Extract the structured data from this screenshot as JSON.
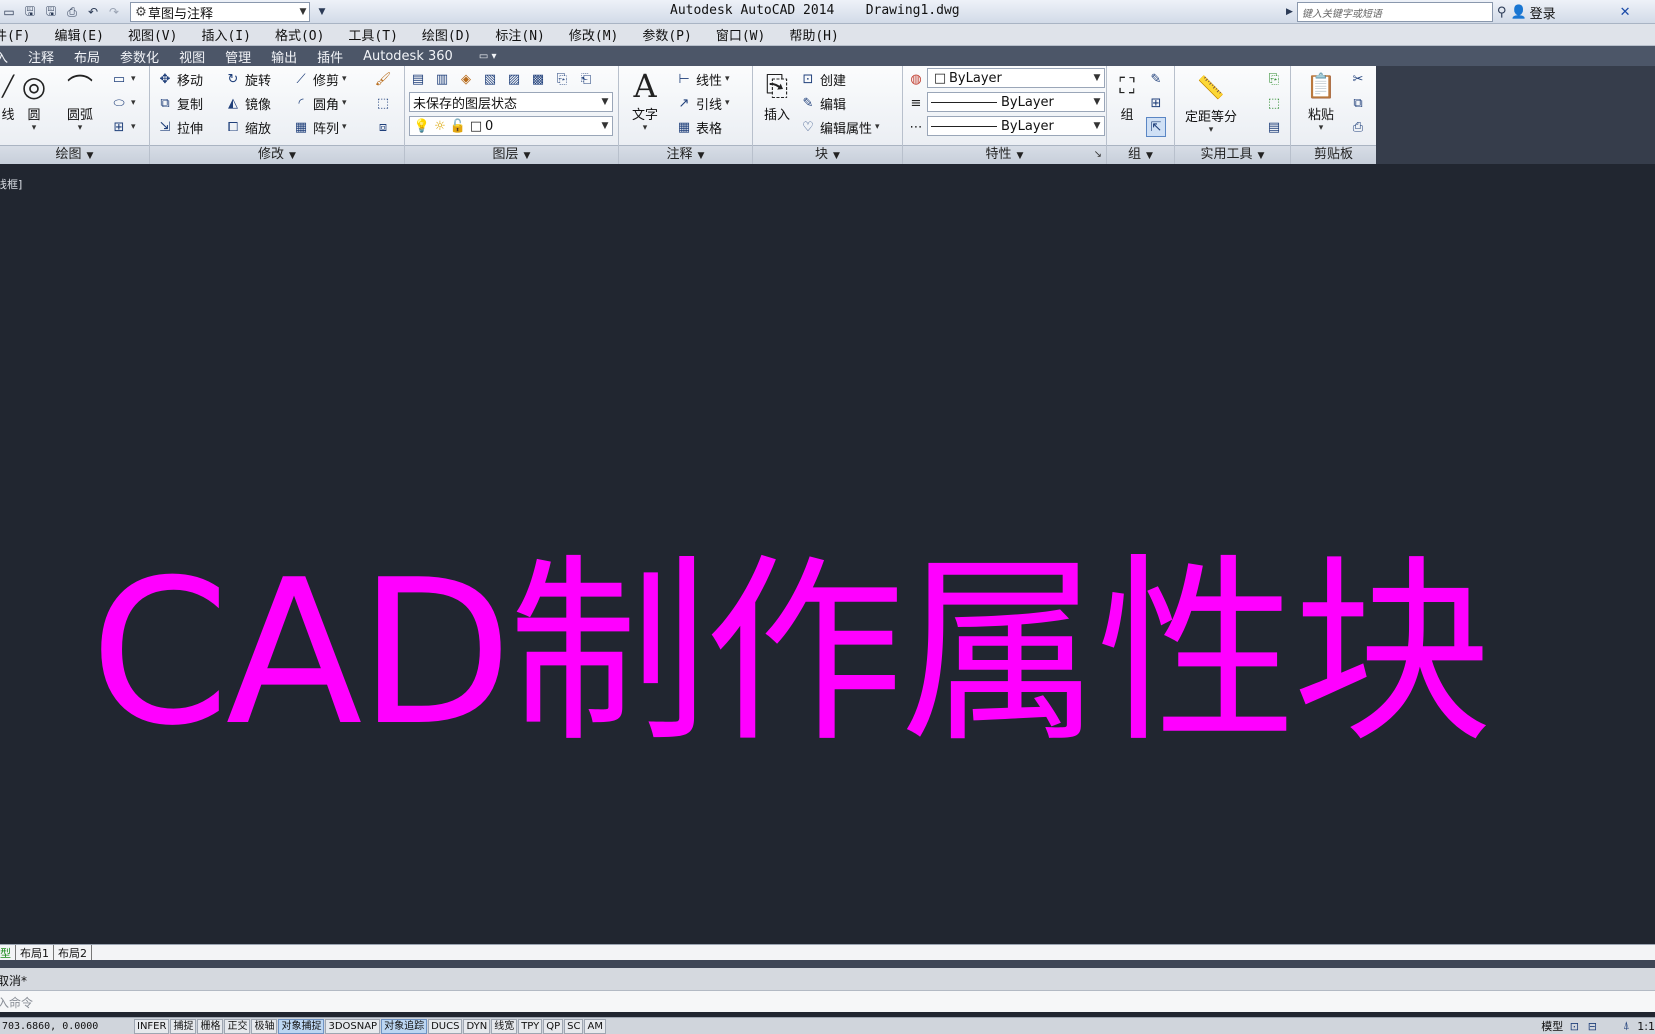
{
  "titlebar": {
    "workspace": "草图与注释",
    "app_title": "Autodesk AutoCAD 2014",
    "file_name": "Drawing1.dwg",
    "search_placeholder": "键入关键字或短语",
    "signin": "登录"
  },
  "menubar": [
    "件(F)",
    "编辑(E)",
    "视图(V)",
    "插入(I)",
    "格式(O)",
    "工具(T)",
    "绘图(D)",
    "标注(N)",
    "修改(M)",
    "参数(P)",
    "窗口(W)",
    "帮助(H)"
  ],
  "ribbon_tabs": [
    "入",
    "注释",
    "布局",
    "参数化",
    "视图",
    "管理",
    "输出",
    "插件",
    "Autodesk 360"
  ],
  "panels": {
    "draw": {
      "title": "绘图",
      "line": "线",
      "circle": "圆",
      "arc": "圆弧"
    },
    "modify": {
      "title": "修改",
      "move": "移动",
      "rotate": "旋转",
      "trim": "修剪",
      "copy": "复制",
      "mirror": "镜像",
      "fillet": "圆角",
      "stretch": "拉伸",
      "scale": "缩放",
      "array": "阵列"
    },
    "layers": {
      "title": "图层",
      "layer_state": "未保存的图层状态",
      "current_layer": "0"
    },
    "annotation": {
      "title": "注释",
      "text": "文字",
      "linear": "线性",
      "leader": "引线",
      "table": "表格"
    },
    "block": {
      "title": "块",
      "insert": "插入",
      "create": "创建",
      "edit": "编辑",
      "edit_attributes": "编辑属性"
    },
    "properties": {
      "title": "特性",
      "color": "ByLayer",
      "lineweight": "ByLayer",
      "linetype": "ByLayer"
    },
    "groups": {
      "title": "组",
      "group": "组"
    },
    "utilities": {
      "title": "实用工具",
      "measure": "定距等分"
    },
    "clipboard": {
      "title": "剪贴板",
      "paste": "粘贴"
    }
  },
  "canvas": {
    "viewport_label": "线框]",
    "overlay_title": "CAD制作属性块",
    "overlay_color": "#ff00ff"
  },
  "layout_tabs": [
    "型",
    "布局1",
    "布局2"
  ],
  "command": {
    "history": "取消*",
    "prompt": "入命令"
  },
  "statusbar": {
    "coords": "703.6860, 0.0000",
    "toggles": [
      {
        "label": "INFER",
        "on": false
      },
      {
        "label": "捕捉",
        "on": false
      },
      {
        "label": "栅格",
        "on": false
      },
      {
        "label": "正交",
        "on": false
      },
      {
        "label": "极轴",
        "on": false
      },
      {
        "label": "对象捕捉",
        "on": true
      },
      {
        "label": "3DOSNAP",
        "on": false
      },
      {
        "label": "对象追踪",
        "on": true
      },
      {
        "label": "DUCS",
        "on": false
      },
      {
        "label": "DYN",
        "on": false
      },
      {
        "label": "线宽",
        "on": false
      },
      {
        "label": "TPY",
        "on": false
      },
      {
        "label": "QP",
        "on": false
      },
      {
        "label": "SC",
        "on": false
      },
      {
        "label": "AM",
        "on": false
      }
    ],
    "model": "模型",
    "scale": "1:1"
  }
}
